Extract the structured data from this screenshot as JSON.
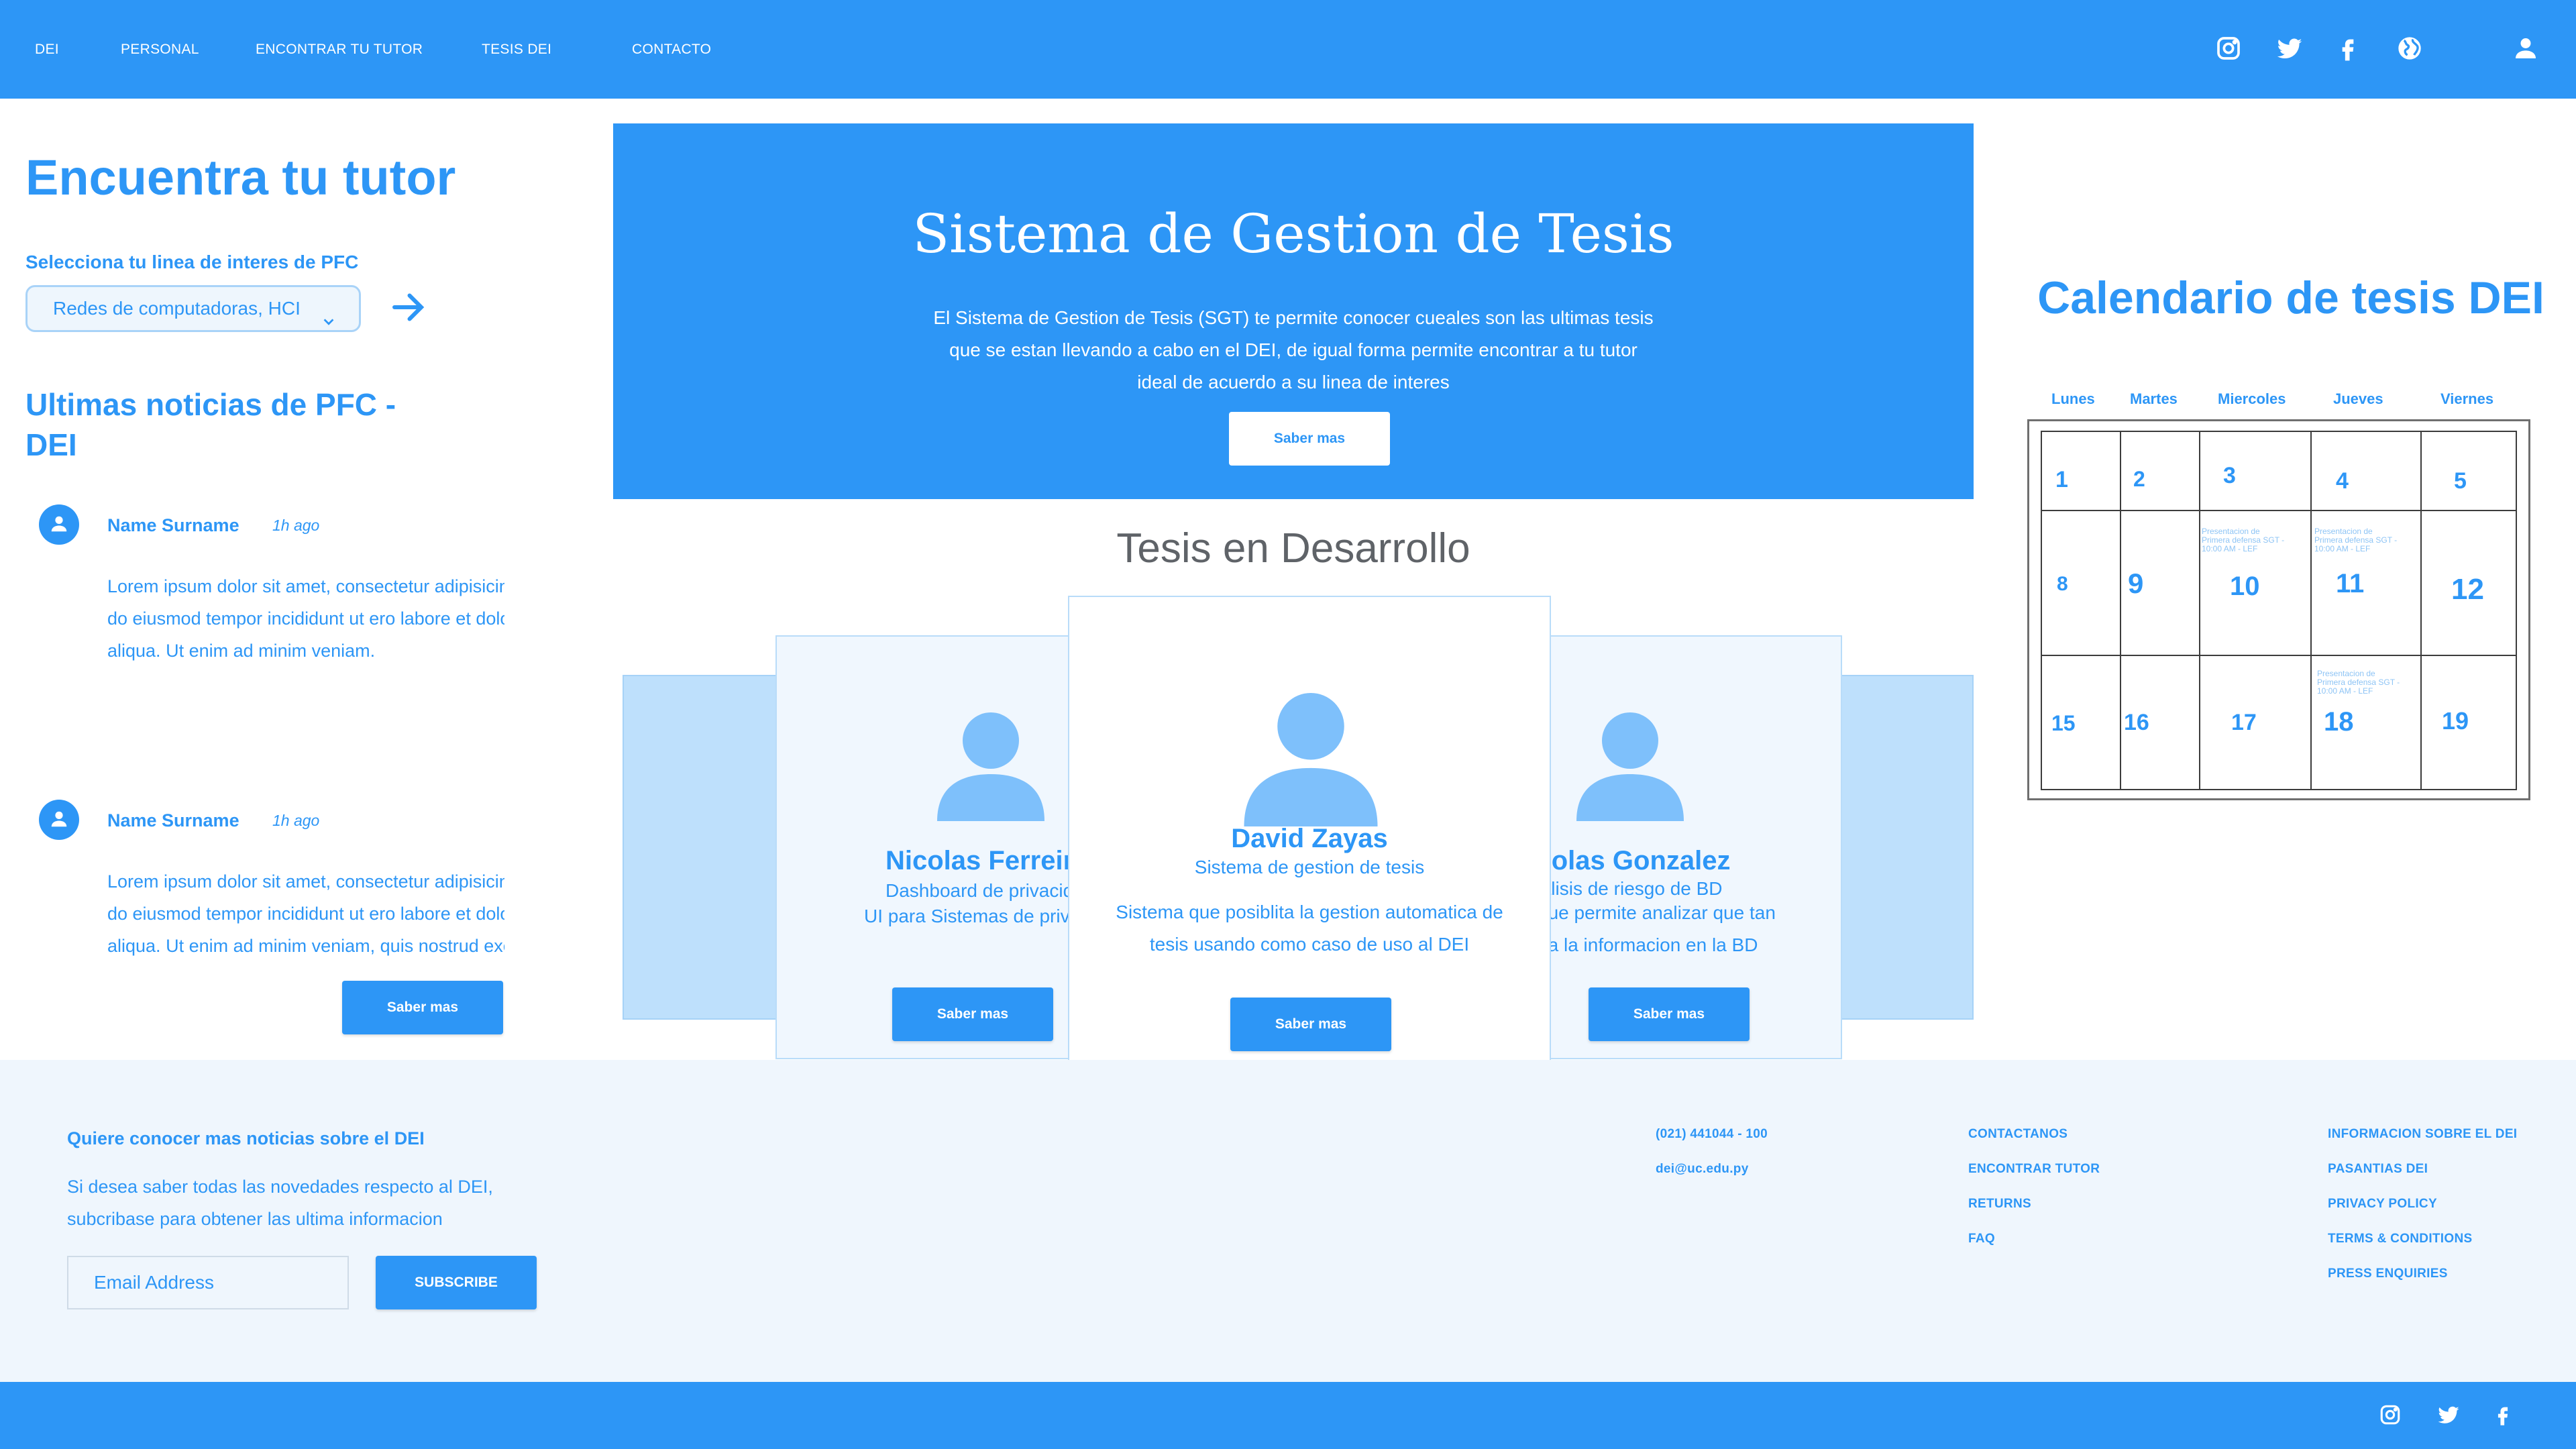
{
  "nav": {
    "items": [
      "DEI",
      "PERSONAL",
      "ENCONTRAR TU TUTOR",
      "TESIS DEI",
      "CONTACTO"
    ]
  },
  "header_icons": [
    "instagram-icon",
    "twitter-icon",
    "facebook-icon",
    "globe-icon",
    "user-icon"
  ],
  "tutor": {
    "title": "Encuentra tu tutor",
    "select_label": "Selecciona tu linea de interes de PFC",
    "select_value": "Redes de computadoras, HCI"
  },
  "news": {
    "title": "Ultimas noticias de PFC - DEI",
    "items": [
      {
        "name": "Name Surname",
        "time": "1h ago",
        "lines": [
          "Lorem ipsum dolor sit amet, consectetur adipisicing elit, sed",
          "do eiusmod tempor incididunt ut ero labore et dolore magna",
          "aliqua. Ut enim ad minim veniam."
        ]
      },
      {
        "name": "Name Surname",
        "time": "1h ago",
        "lines": [
          "Lorem ipsum dolor sit amet, consectetur adipisicing elit, sed",
          "do eiusmod tempor incididunt ut ero labore et dolore magna",
          "aliqua. Ut enim ad minim veniam, quis nostrud exercitation"
        ]
      }
    ],
    "button": "Saber mas"
  },
  "hero": {
    "title": "Sistema de Gestion de Tesis",
    "description": [
      "El Sistema de Gestion de Tesis (SGT) te permite conocer cueales son las ultimas tesis",
      "que se estan llevando a cabo en el DEI, de igual forma permite encontrar a tu tutor",
      "ideal de acuerdo a su linea de interes"
    ],
    "button": "Saber mas"
  },
  "tesis": {
    "title": "Tesis en Desarrollo",
    "cards": [
      {
        "name": "Nicolas Ferreira",
        "topic_lines": [
          "Dashboard de privacidad",
          "UI para Sistemas de privacidad"
        ],
        "desc_lines": [],
        "button": "Saber mas"
      },
      {
        "name": "David Zayas",
        "topic_lines": [
          "Sistema de gestion de tesis"
        ],
        "desc_lines": [
          "Sistema que posiblita la gestion automatica de",
          "tesis usando como caso de uso al DEI"
        ],
        "button": "Saber mas"
      },
      {
        "name": "Nicolas Gonzalez",
        "topic_lines": [
          "Analisis de riesgo de BD"
        ],
        "desc_lines": [
          "Sistema que permite analizar que tan",
          "expuesta la informacion en la BD"
        ],
        "button": "Saber mas"
      }
    ]
  },
  "calendar": {
    "title": "Calendario de tesis DEI",
    "days": [
      "Lunes",
      "Martes",
      "Miercoles",
      "Jueves",
      "Viernes"
    ],
    "weeks": [
      [
        "1",
        "2",
        "3",
        "4",
        "5"
      ],
      [
        "8",
        "9",
        "10",
        "11",
        "12"
      ],
      [
        "15",
        "16",
        "17",
        "18",
        "19"
      ]
    ],
    "events": [
      {
        "day": "10",
        "lines": [
          "Presentacion de",
          "Primera defensa SGT -",
          "10:00 AM - LEF"
        ]
      },
      {
        "day": "11",
        "lines": [
          "Presentacion de",
          "Primera defensa SGT -",
          "10:00 AM - LEF"
        ]
      },
      {
        "day": "18",
        "lines": [
          "Presentacion de",
          "Primera defensa SGT -",
          "10:00 AM - LEF"
        ]
      }
    ]
  },
  "footer": {
    "newsletter_title": "Quiere conocer mas noticias sobre el DEI",
    "newsletter_desc": "Si desea saber todas las novedades respecto al DEI, subcribase para obtener las ultima informacion",
    "email_placeholder": "Email Address",
    "subscribe": "SUBSCRIBE",
    "contact": [
      "(021) 441044 - 100",
      "dei@uc.edu.py"
    ],
    "links_col1": [
      "CONTACTANOS",
      "ENCONTRAR TUTOR",
      "RETURNS",
      "FAQ"
    ],
    "links_col2": [
      "INFORMACION SOBRE EL DEI",
      "PASANTIAS DEI",
      "PRIVACY POLICY",
      "TERMS & CONDITIONS",
      "PRESS ENQUIRIES"
    ],
    "social_icons": [
      "instagram-icon",
      "twitter-icon",
      "facebook-icon"
    ]
  },
  "colors": {
    "primary": "#2d96f6",
    "light_panel": "#bee0fc",
    "card_bg": "#f0f7fe",
    "footer_bg": "#eff6fd",
    "avatar": "#7ec0fb"
  }
}
